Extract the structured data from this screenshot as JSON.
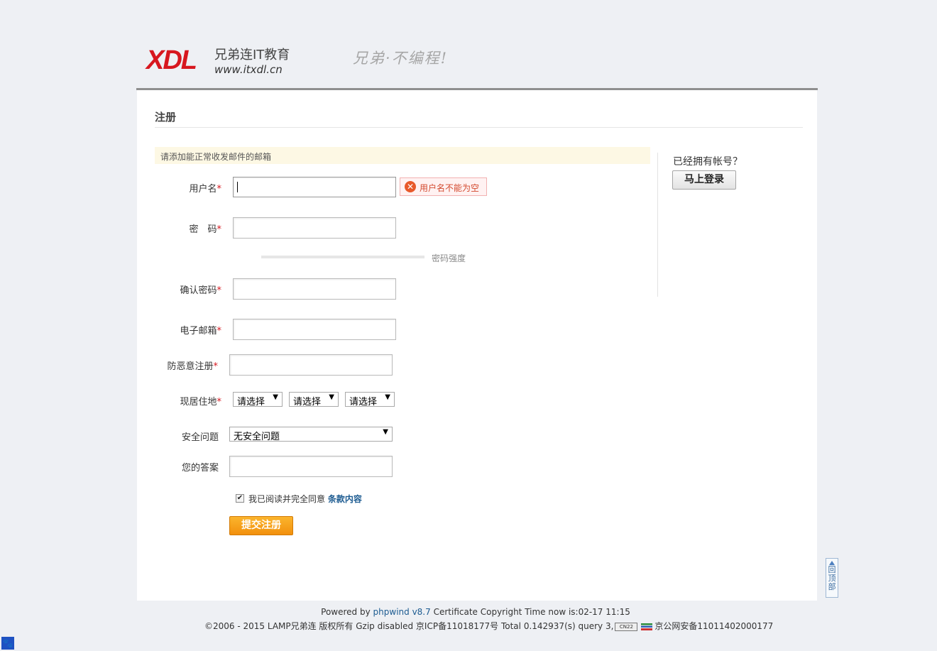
{
  "header": {
    "logo_mark": "XDL",
    "logo_name": "兄弟连IT教育",
    "logo_url": "www.itxdl.cn",
    "slogan": "兄弟·不编程!"
  },
  "page_title": "注册",
  "notice": "请添加能正常收发邮件的邮箱",
  "fields": {
    "username": {
      "label": "用户名",
      "value": "",
      "error": "用户名不能为空"
    },
    "password": {
      "label": "密　码",
      "value": "",
      "strength_label": "密码强度"
    },
    "confirm_password": {
      "label": "确认密码",
      "value": ""
    },
    "email": {
      "label": "电子邮箱",
      "value": ""
    },
    "anti_spam": {
      "label": "防恶意注册",
      "value": ""
    },
    "residence": {
      "label": "现居住地",
      "province": "请选择",
      "city": "请选择",
      "district": "请选择"
    },
    "security_question": {
      "label": "安全问题",
      "value": "无安全问题"
    },
    "answer": {
      "label": "您的答案",
      "value": ""
    }
  },
  "required_mark": "*",
  "agreement": {
    "text": "我已阅读并完全同意",
    "link": "条款内容",
    "checked": true
  },
  "submit_label": "提交注册",
  "sidebar": {
    "prompt": "已经拥有帐号？",
    "login_label": "马上登录"
  },
  "back_to_top": "回顶部",
  "footer": {
    "powered_prefix": "Powered by",
    "powered_link": "phpwind v8.7",
    "powered_suffix": "Certificate Copyright Time now is:02-17 11:15",
    "line2_main": "©2006 - 2015 LAMP兄弟连 版权所有 Gzip disabled 京ICP备11018177号 Total 0.142937(s) query 3,",
    "badge": "CN22",
    "line2_tail": "京公网安备11011402000177"
  },
  "colors": {
    "accent_red": "#d7171f",
    "submit_orange": "#f2900d",
    "link_blue": "#1c5b91"
  }
}
